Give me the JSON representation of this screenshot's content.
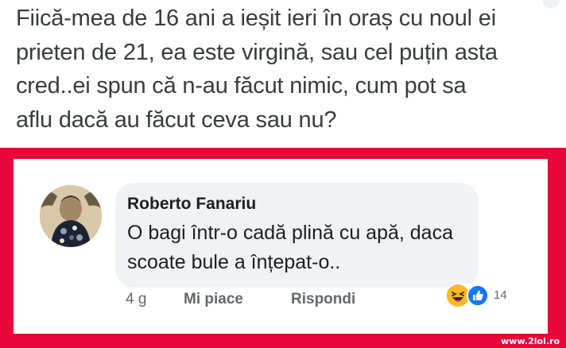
{
  "post": {
    "lines": [
      "Fiică-mea de 16 ani a ieșit ieri în oraș cu noul ei",
      "prieten de 21, ea este virgină, sau cel puțin asta",
      "cred..ei spun că n-au făcut nimic, cum pot sa",
      "aflu dacă au făcut ceva sau nu?"
    ]
  },
  "comment": {
    "author": "Roberto Fanariu",
    "lines": [
      "O bagi într-o cadă plină cu apă, daca",
      "scoate bule a înțepat-o.."
    ],
    "time": "4 g",
    "like_label": "Mi piace",
    "reply_label": "Rispondi",
    "reaction_count": "14",
    "reactions": [
      "haha-icon",
      "like-icon"
    ]
  },
  "watermark": "www.2lol.ro",
  "colors": {
    "frame": "#e8073a",
    "bubble": "#f0f2f5",
    "like_blue": "#1877f2",
    "haha_yellow": "#f7b928"
  }
}
